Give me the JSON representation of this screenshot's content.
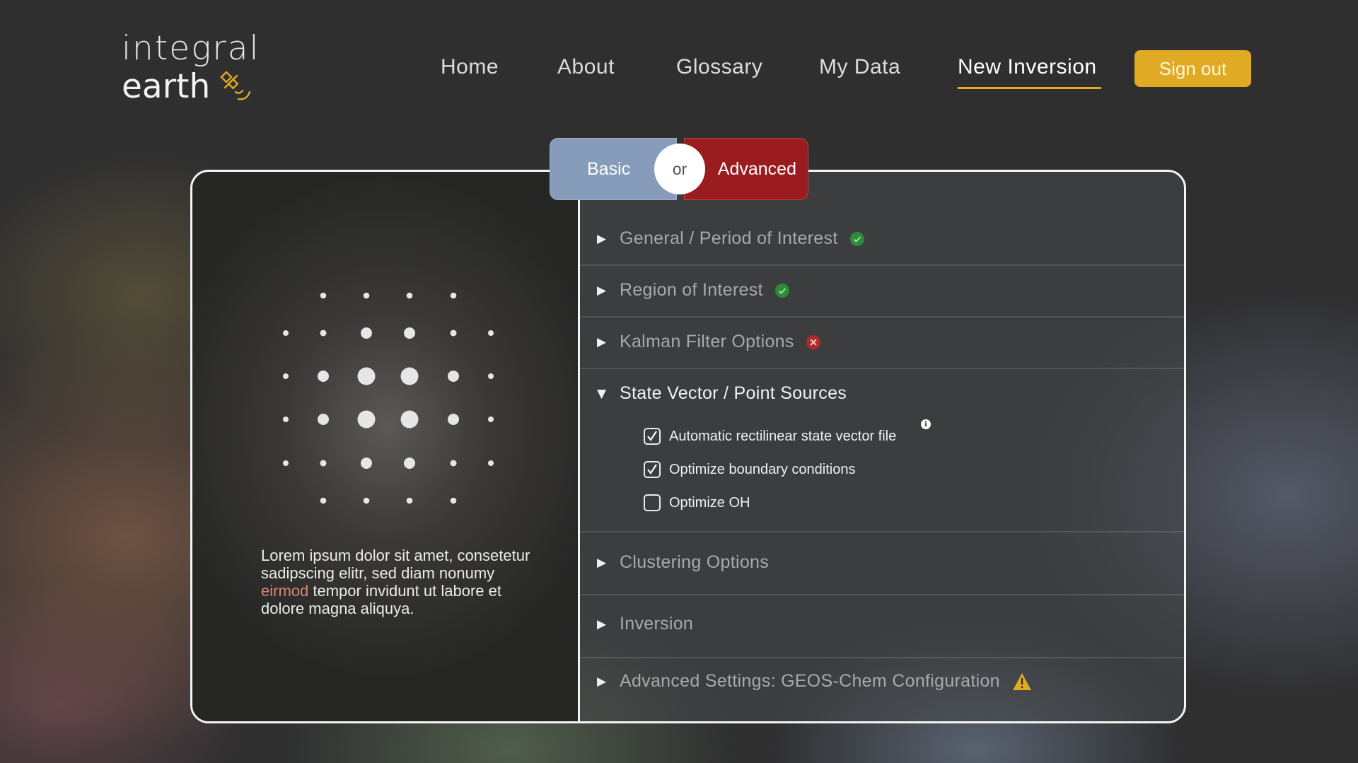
{
  "brand": {
    "line1": "integral",
    "line2": "earth"
  },
  "nav": {
    "items": [
      "Home",
      "About",
      "Glossary",
      "My Data",
      "New Inversion"
    ],
    "active": "New Inversion",
    "sign_out": "Sign out"
  },
  "mode_toggle": {
    "basic": "Basic",
    "or": "or",
    "advanced": "Advanced"
  },
  "description": {
    "before": "Lorem ipsum dolor sit amet, consetetur sadipscing elitr, sed diam nonumy ",
    "highlight": "eirmod",
    "after": " tempor invidunt ut labore et dolore magna aliquya."
  },
  "sections": [
    {
      "title": "General / Period of Interest",
      "status": "complete",
      "expanded": false
    },
    {
      "title": "Region of Interest",
      "status": "complete",
      "expanded": false
    },
    {
      "title": "Kalman Filter Options",
      "status": "error",
      "expanded": false
    },
    {
      "title": "State Vector / Point Sources",
      "status": "none",
      "expanded": true,
      "options": [
        {
          "label": "Automatic rectilinear state vector file",
          "checked": true,
          "info": true
        },
        {
          "label": "Optimize boundary conditions",
          "checked": true,
          "info": false
        },
        {
          "label": "Optimize OH",
          "checked": false,
          "info": false
        }
      ]
    },
    {
      "title": "Clustering Options",
      "status": "none",
      "expanded": false
    },
    {
      "title": "Inversion",
      "status": "none",
      "expanded": false
    },
    {
      "title": "Advanced Settings: GEOS-Chem Configuration",
      "status": "warning",
      "expanded": false
    }
  ],
  "colors": {
    "accent": "#e0aa24",
    "basic": "#869cba",
    "advanced": "#9b1c1f",
    "complete": "#2e8b3a",
    "error": "#b02a2a",
    "warning": "#e0aa24",
    "highlight_text": "#d98577"
  },
  "icons": {
    "logo": "satellite-icon",
    "complete": "check-circle-icon",
    "error": "x-circle-icon",
    "warning": "warning-triangle-icon",
    "info": "info-icon",
    "collapsed": "triangle-right-icon",
    "expanded": "triangle-down-icon"
  }
}
